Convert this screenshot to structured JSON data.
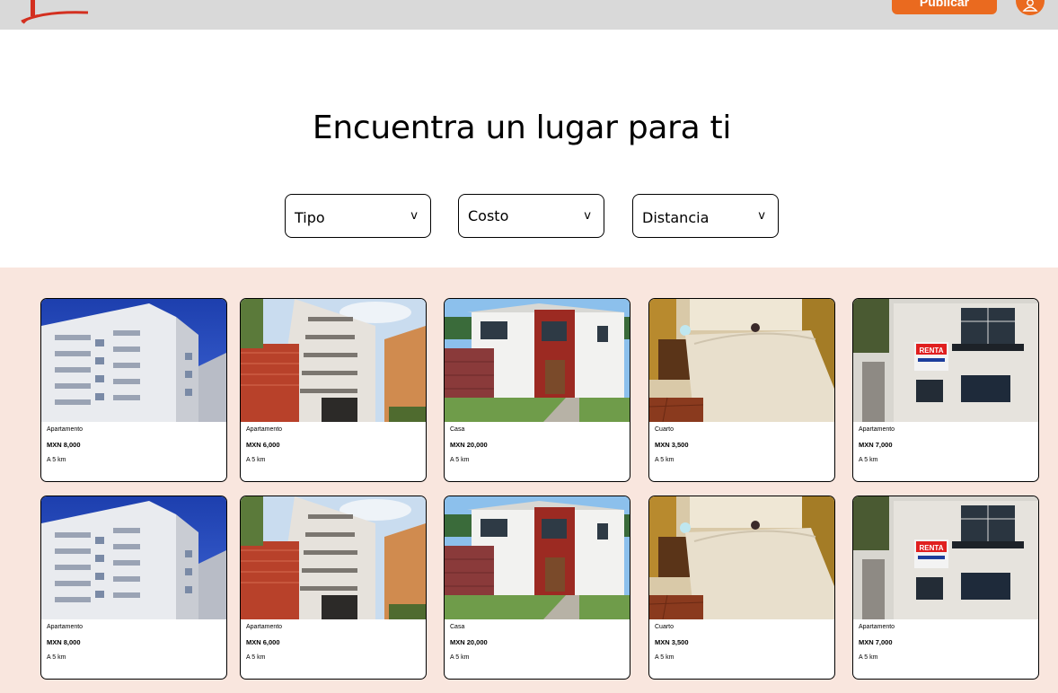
{
  "header": {
    "publish_label": "Publicar",
    "brand_color": "#ea6a1f",
    "icons": [
      "logo-swoosh",
      "user-icon"
    ]
  },
  "hero": {
    "title": "Encuentra un lugar para ti"
  },
  "filters": [
    {
      "label": "Tipo",
      "chevron": "v"
    },
    {
      "label": "Costo",
      "chevron": "v"
    },
    {
      "label": "Distancia",
      "chevron": "v"
    }
  ],
  "listings": [
    {
      "type": "Apartamento",
      "price": "MXN  8,000",
      "distance": "A 5 km",
      "photo": "white-apartment-tower"
    },
    {
      "type": "Apartamento",
      "price": "MXN  6,000",
      "distance": "A 5 km",
      "photo": "apartment-building-red-facade"
    },
    {
      "type": "Casa",
      "price": "MXN  20,000",
      "distance": "A 5 km",
      "photo": "white-red-house"
    },
    {
      "type": "Cuarto",
      "price": "MXN  3,500",
      "distance": "A 5 km",
      "photo": "bedroom"
    },
    {
      "type": "Apartamento",
      "price": "MXN  7,000",
      "distance": "A 5 km",
      "photo": "building-with-renta-sign"
    },
    {
      "type": "Apartamento",
      "price": "MXN  8,000",
      "distance": "A 5 km",
      "photo": "white-apartment-tower"
    },
    {
      "type": "Apartamento",
      "price": "MXN  6,000",
      "distance": "A 5 km",
      "photo": "apartment-building-red-facade"
    },
    {
      "type": "Casa",
      "price": "MXN  20,000",
      "distance": "A 5 km",
      "photo": "white-red-house"
    },
    {
      "type": "Cuarto",
      "price": "MXN  3,500",
      "distance": "A 5 km",
      "photo": "bedroom"
    },
    {
      "type": "Apartamento",
      "price": "MXN  7,000",
      "distance": "A 5 km",
      "photo": "building-with-renta-sign"
    }
  ],
  "renta_sign_text": "RENTA",
  "colors": {
    "topbar": "#d9d9d9",
    "listings_background": "#f9e6de",
    "accent": "#ea6a1f"
  }
}
